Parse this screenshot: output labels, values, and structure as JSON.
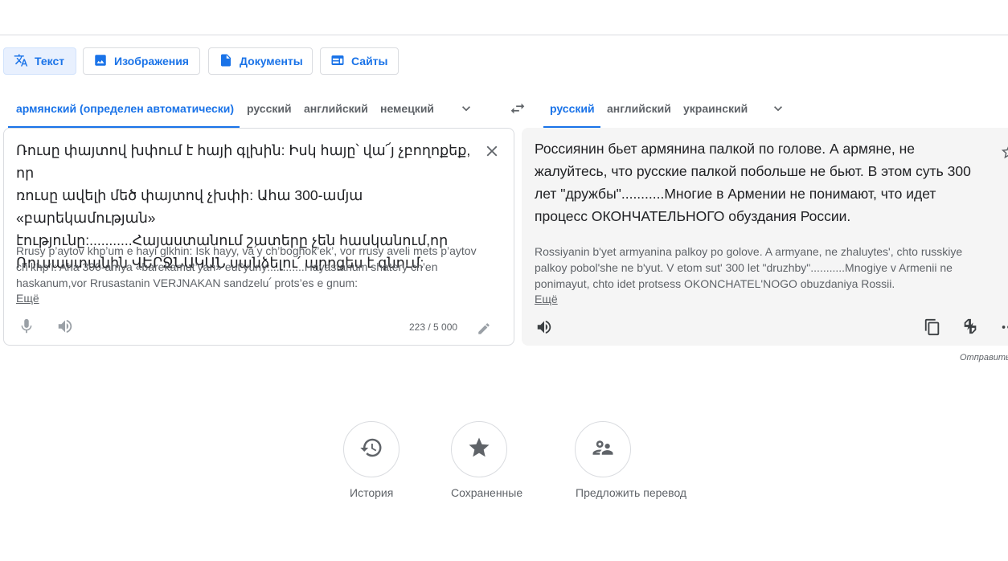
{
  "mode_tabs": [
    {
      "label": "Текст",
      "icon": "translate-icon",
      "active": true
    },
    {
      "label": "Изображения",
      "icon": "image-icon",
      "active": false
    },
    {
      "label": "Документы",
      "icon": "document-icon",
      "active": false
    },
    {
      "label": "Сайты",
      "icon": "website-icon",
      "active": false
    }
  ],
  "source_langs": [
    "армянский (определен автоматически)",
    "русский",
    "английский",
    "немецкий"
  ],
  "target_langs": [
    "русский",
    "английский",
    "украинский"
  ],
  "source": {
    "text_lines": [
      "Ռուսը փայտով խփում է հայի գլխին: Իսկ հայը՝ վա՜յ չբողոքեք, որ",
      "ռուսը ավելի մեծ փայտով չխփի: Ահա 300-ամյա «բարեկամության»",
      "էությունը:...........Հայաստանում շատերը չեն հասկանում,որ",
      "Ռուսաստանին ՎԵՐՋՆԱԿԱՆ սանձելու՛ պրոցես է գնում:"
    ],
    "translit_lines": [
      "Rrusy p’aytov khp’um e hayi glkhin: Isk hayy, va՛y ch’boghok’ek’, vor rrusy aveli mets p’aytov",
      "ch’khp’i: Aha 300-amya «barekamut’yan» eut’yuny:...........Hayastanum shatery ch’en",
      "haskanum,vor Rrusastanin VERJNAKAN sandzelu՛ prots’es e gnum:"
    ],
    "more_label": "Ещё",
    "char_count": "223 / 5 000"
  },
  "target": {
    "text_lines": [
      "Россиянин бьет армянина палкой по голове. А армяне, не",
      "жалуйтесь, что русские палкой побольше не бьют. В этом суть 300",
      "лет \"дружбы\"...........Многие в Армении не понимают, что идет",
      "процесс ОКОНЧАТЕЛЬНОГО обуздания России."
    ],
    "translit_lines": [
      "Rossiyanin b'yet armyanina palkoy po golove. A armyane, ne zhaluytes', chto russkiye",
      "palkoy pobol'she ne b'yut. V etom sut' 300 let \"druzhby\"...........Mnogiye v Armenii ne",
      "ponimayut, chto idet protsess OKONCHATEL'NOGO obuzdaniya Rossii."
    ],
    "more_label": "Ещё",
    "feedback_label": "Отправить о"
  },
  "bottom_actions": [
    {
      "label": "История",
      "icon": "history-icon"
    },
    {
      "label": "Сохраненные",
      "icon": "star-icon"
    },
    {
      "label": "Предложить перевод",
      "icon": "people-icon"
    }
  ],
  "colors": {
    "accent": "#1a73e8",
    "muted": "#5f6368",
    "target_bg": "#f5f5f5"
  }
}
